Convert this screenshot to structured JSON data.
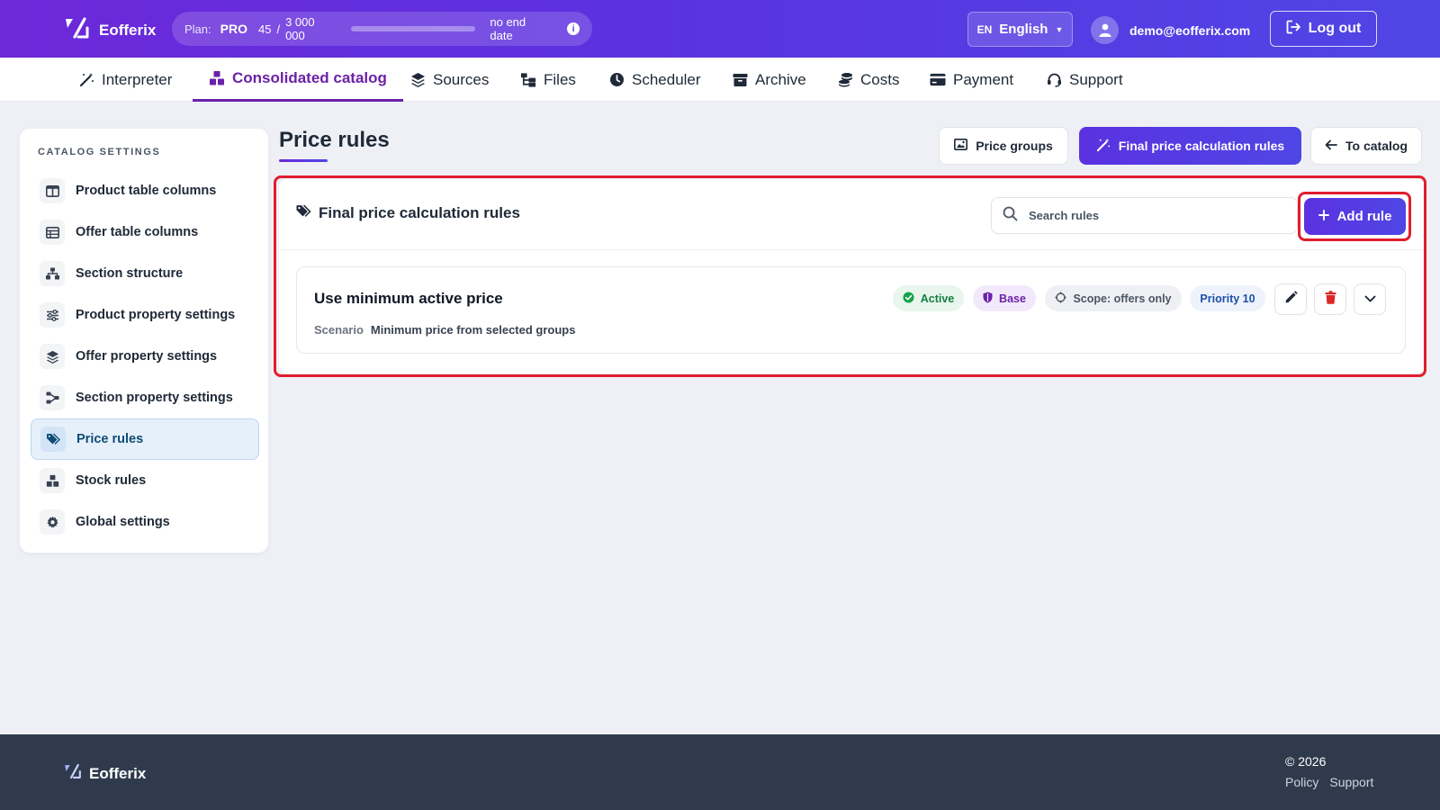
{
  "brand": {
    "name": "Eofferix"
  },
  "plan": {
    "label": "Plan:",
    "tier": "PRO",
    "used": "45",
    "separator": "/",
    "limit": "3 000 000",
    "usage_fraction": 1.5e-05,
    "end_text": "no end date",
    "info_glyph": "i"
  },
  "language": {
    "code": "EN",
    "name": "English"
  },
  "user": {
    "email": "demo@eofferix.com"
  },
  "logout": {
    "label": "Log out"
  },
  "nav": {
    "items": [
      {
        "label": "Interpreter",
        "icon": "magic-wand-icon"
      },
      {
        "label": "Consolidated catalog",
        "icon": "boxes-icon",
        "active": true
      },
      {
        "label": "Sources",
        "icon": "layers-icon"
      },
      {
        "label": "Files",
        "icon": "folder-tree-icon"
      },
      {
        "label": "Scheduler",
        "icon": "clock-icon"
      },
      {
        "label": "Archive",
        "icon": "archive-icon"
      },
      {
        "label": "Costs",
        "icon": "coins-icon"
      },
      {
        "label": "Payment",
        "icon": "credit-card-icon"
      },
      {
        "label": "Support",
        "icon": "headset-icon"
      }
    ]
  },
  "sidebar": {
    "title": "CATALOG SETTINGS",
    "items": [
      {
        "label": "Product table columns",
        "icon": "columns-icon"
      },
      {
        "label": "Offer table columns",
        "icon": "table-icon"
      },
      {
        "label": "Section structure",
        "icon": "sitemap-icon"
      },
      {
        "label": "Product property settings",
        "icon": "sliders-icon"
      },
      {
        "label": "Offer property settings",
        "icon": "layers-icon"
      },
      {
        "label": "Section property settings",
        "icon": "share-nodes-icon"
      },
      {
        "label": "Price rules",
        "icon": "tags-icon",
        "active": true
      },
      {
        "label": "Stock rules",
        "icon": "boxes-icon"
      },
      {
        "label": "Global settings",
        "icon": "gear-icon"
      }
    ]
  },
  "page": {
    "title": "Price rules",
    "buttons": {
      "price_groups": "Price groups",
      "final_rules": "Final price calculation rules",
      "to_catalog": "To catalog"
    }
  },
  "panel": {
    "title": "Final price calculation rules",
    "search_placeholder": "Search rules",
    "add_label": "Add rule"
  },
  "rules": [
    {
      "name": "Use minimum active price",
      "scenario_label": "Scenario",
      "scenario_value": "Minimum price from selected groups",
      "status": "Active",
      "type": "Base",
      "scope": "Scope: offers only",
      "priority": "Priority 10"
    }
  ],
  "footer": {
    "brand": "Eofferix",
    "copyright": "© 2026",
    "links": [
      "Policy",
      "Support"
    ]
  },
  "colors": {
    "header_gradient_start": "#6d28d9",
    "header_gradient_end": "#4f46e5",
    "accent": "#6b21a8",
    "highlight": "#e11d2e",
    "footer_bg": "#2f3b4c",
    "active_green": "#15803d"
  }
}
